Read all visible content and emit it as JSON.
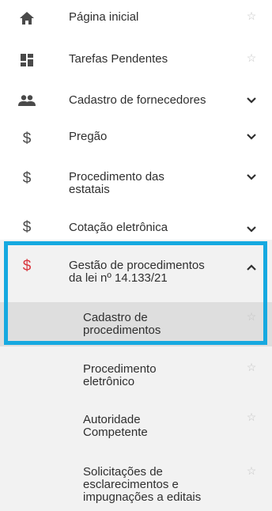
{
  "colors": {
    "active_icon": "#d9373f",
    "highlight_border": "#16a9e0",
    "submenu_bg": "#f2f2f2",
    "selected_bg": "#dedede"
  },
  "menu": [
    {
      "label": "Página inicial",
      "icon": "home-icon",
      "trail": "star"
    },
    {
      "label": "Tarefas Pendentes",
      "icon": "dashboard-icon",
      "trail": "star"
    },
    {
      "label": "Cadastro de fornecedores",
      "icon": "people-icon",
      "trail": "chevron-down"
    },
    {
      "label": "Pregão",
      "icon": "dollar-icon",
      "trail": "chevron-down"
    },
    {
      "label": "Procedimento das\nestatais",
      "icon": "dollar-icon",
      "trail": "chevron-down"
    },
    {
      "label": "Cotação eletrônica",
      "icon": "dollar-icon",
      "trail": "chevron-down"
    },
    {
      "label": "Gestão de procedimentos\nda lei nº 14.133/21",
      "icon": "dollar-icon",
      "trail": "chevron-up",
      "expanded": true
    }
  ],
  "submenu": [
    {
      "label": "Cadastro de\nprocedimentos",
      "selected": true
    },
    {
      "label": "Procedimento\neletrônico"
    },
    {
      "label": "Autoridade\nCompetente"
    },
    {
      "label": "Solicitações de\nesclarecimentos e\nimpugnações a editais"
    }
  ]
}
